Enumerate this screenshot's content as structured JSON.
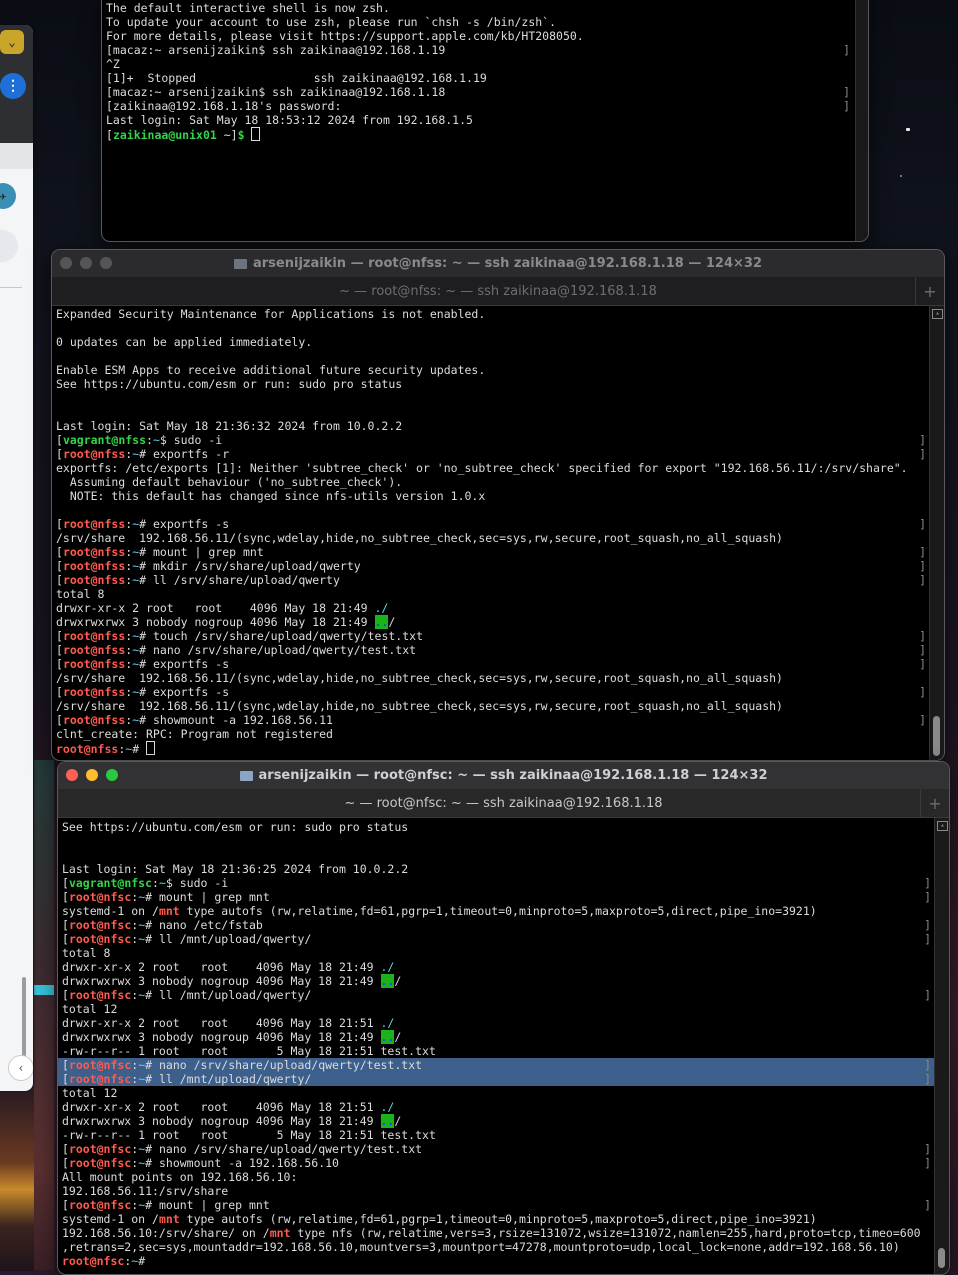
{
  "terminal1": {
    "lines": [
      {
        "t": "The default interactive shell is now zsh."
      },
      {
        "t": "To update your account to use zsh, please run `chsh -s /bin/zsh`."
      },
      {
        "t": "For more details, please visit https://support.apple.com/kb/HT208050."
      },
      {
        "t": "[macaz:~ arsenijzaikin$ ssh zaikinaa@192.168.1.19",
        "rb": "]"
      },
      {
        "t": "^Z"
      },
      {
        "t": "[1]+  Stopped                 ssh zaikinaa@192.168.1.19"
      },
      {
        "t": "[macaz:~ arsenijzaikin$ ssh zaikinaa@192.168.1.18",
        "rb": "]"
      },
      {
        "t": "[zaikinaa@192.168.1.18's password:",
        "rb": "]"
      },
      {
        "t": "Last login: Sat May 18 18:53:12 2024 from 192.168.1.5"
      },
      {
        "segs": [
          {
            "t": "["
          },
          {
            "t": "zaikinaa@unix01",
            "c": "u"
          },
          {
            "t": " ~]"
          },
          {
            "t": "$",
            "c": "u"
          },
          {
            "t": " "
          }
        ],
        "cursor": true
      }
    ]
  },
  "terminal2": {
    "title": "arsenijzaikin — root@nfss: ~ — ssh zaikinaa@192.168.1.18 — 124×32",
    "tab": "~ — root@nfss: ~ — ssh zaikinaa@192.168.1.18",
    "lines": [
      {
        "t": "Expanded Security Maintenance for Applications is not enabled."
      },
      {
        "t": ""
      },
      {
        "t": "0 updates can be applied immediately."
      },
      {
        "t": ""
      },
      {
        "t": "Enable ESM Apps to receive additional future security updates."
      },
      {
        "t": "See https://ubuntu.com/esm or run: sudo pro status"
      },
      {
        "t": ""
      },
      {
        "t": ""
      },
      {
        "t": "Last login: Sat May 18 21:36:32 2024 from 10.0.2.2"
      },
      {
        "segs": [
          {
            "t": "["
          },
          {
            "t": "vagrant@nfss",
            "c": "u"
          },
          {
            "t": ":"
          },
          {
            "t": "~",
            "c": "d"
          },
          {
            "t": "$ sudo -i"
          }
        ],
        "rb": "]"
      },
      {
        "segs": [
          {
            "t": "["
          },
          {
            "t": "root@nfss",
            "c": "r"
          },
          {
            "t": ":"
          },
          {
            "t": "~",
            "c": "d"
          },
          {
            "t": "# exportfs -r"
          }
        ],
        "rb": "]"
      },
      {
        "t": "exportfs: /etc/exports [1]: Neither 'subtree_check' or 'no_subtree_check' specified for export \"192.168.56.11/:/srv/share\"."
      },
      {
        "t": "  Assuming default behaviour ('no_subtree_check')."
      },
      {
        "t": "  NOTE: this default has changed since nfs-utils version 1.0.x"
      },
      {
        "t": ""
      },
      {
        "segs": [
          {
            "t": "["
          },
          {
            "t": "root@nfss",
            "c": "r"
          },
          {
            "t": ":"
          },
          {
            "t": "~",
            "c": "d"
          },
          {
            "t": "# exportfs -s"
          }
        ],
        "rb": "]"
      },
      {
        "t": "/srv/share  192.168.56.11/(sync,wdelay,hide,no_subtree_check,sec=sys,rw,secure,root_squash,no_all_squash)"
      },
      {
        "segs": [
          {
            "t": "["
          },
          {
            "t": "root@nfss",
            "c": "r"
          },
          {
            "t": ":"
          },
          {
            "t": "~",
            "c": "d"
          },
          {
            "t": "# mount | grep mnt"
          }
        ],
        "rb": "]"
      },
      {
        "segs": [
          {
            "t": "["
          },
          {
            "t": "root@nfss",
            "c": "r"
          },
          {
            "t": ":"
          },
          {
            "t": "~",
            "c": "d"
          },
          {
            "t": "# mkdir /srv/share/upload/qwerty"
          }
        ],
        "rb": "]"
      },
      {
        "segs": [
          {
            "t": "["
          },
          {
            "t": "root@nfss",
            "c": "r"
          },
          {
            "t": ":"
          },
          {
            "t": "~",
            "c": "d"
          },
          {
            "t": "# ll /srv/share/upload/qwerty"
          }
        ],
        "rb": "]"
      },
      {
        "t": "total 8"
      },
      {
        "segs": [
          {
            "t": "drwxr-xr-x 2 root   root    4096 May 18 21:49 "
          },
          {
            "t": "./",
            "c": "d"
          }
        ]
      },
      {
        "segs": [
          {
            "t": "drwxrwxrwx 3 nobody nogroup 4096 May 18 21:49 "
          },
          {
            "t": "..",
            "c": "gbg"
          },
          {
            "t": "/"
          }
        ]
      },
      {
        "segs": [
          {
            "t": "["
          },
          {
            "t": "root@nfss",
            "c": "r"
          },
          {
            "t": ":"
          },
          {
            "t": "~",
            "c": "d"
          },
          {
            "t": "# touch /srv/share/upload/qwerty/test.txt"
          }
        ],
        "rb": "]"
      },
      {
        "segs": [
          {
            "t": "["
          },
          {
            "t": "root@nfss",
            "c": "r"
          },
          {
            "t": ":"
          },
          {
            "t": "~",
            "c": "d"
          },
          {
            "t": "# nano /srv/share/upload/qwerty/test.txt"
          }
        ],
        "rb": "]"
      },
      {
        "segs": [
          {
            "t": "["
          },
          {
            "t": "root@nfss",
            "c": "r"
          },
          {
            "t": ":"
          },
          {
            "t": "~",
            "c": "d"
          },
          {
            "t": "# exportfs -s"
          }
        ],
        "rb": "]"
      },
      {
        "t": "/srv/share  192.168.56.11/(sync,wdelay,hide,no_subtree_check,sec=sys,rw,secure,root_squash,no_all_squash)"
      },
      {
        "segs": [
          {
            "t": "["
          },
          {
            "t": "root@nfss",
            "c": "r"
          },
          {
            "t": ":"
          },
          {
            "t": "~",
            "c": "d"
          },
          {
            "t": "# exportfs -s"
          }
        ],
        "rb": "]"
      },
      {
        "t": "/srv/share  192.168.56.11/(sync,wdelay,hide,no_subtree_check,sec=sys,rw,secure,root_squash,no_all_squash)"
      },
      {
        "segs": [
          {
            "t": "["
          },
          {
            "t": "root@nfss",
            "c": "r"
          },
          {
            "t": ":"
          },
          {
            "t": "~",
            "c": "d"
          },
          {
            "t": "# showmount -a 192.168.56.11"
          }
        ],
        "rb": "]"
      },
      {
        "t": "clnt_create: RPC: Program not registered"
      },
      {
        "segs": [
          {
            "t": "root@nfss",
            "c": "r"
          },
          {
            "t": ":"
          },
          {
            "t": "~",
            "c": "d"
          },
          {
            "t": "# "
          }
        ],
        "cursor": true
      }
    ]
  },
  "terminal3": {
    "title": "arsenijzaikin — root@nfsc: ~ — ssh zaikinaa@192.168.1.18 — 124×32",
    "tab": "~ — root@nfsc: ~ — ssh zaikinaa@192.168.1.18",
    "lines": [
      {
        "t": "See https://ubuntu.com/esm or run: sudo pro status"
      },
      {
        "t": ""
      },
      {
        "t": ""
      },
      {
        "t": "Last login: Sat May 18 21:36:25 2024 from 10.0.2.2"
      },
      {
        "segs": [
          {
            "t": "["
          },
          {
            "t": "vagrant@nfsc",
            "c": "u"
          },
          {
            "t": ":"
          },
          {
            "t": "~",
            "c": "d"
          },
          {
            "t": "$ sudo -i"
          }
        ],
        "rb": "]"
      },
      {
        "segs": [
          {
            "t": "["
          },
          {
            "t": "root@nfsc",
            "c": "r"
          },
          {
            "t": ":"
          },
          {
            "t": "~",
            "c": "d"
          },
          {
            "t": "# mount | grep mnt"
          }
        ],
        "rb": "]"
      },
      {
        "segs": [
          {
            "t": "systemd-1 on /"
          },
          {
            "t": "mnt",
            "c": "r"
          },
          {
            "t": " type autofs (rw,relatime,fd=61,pgrp=1,timeout=0,minproto=5,maxproto=5,direct,pipe_ino=3921)"
          }
        ]
      },
      {
        "segs": [
          {
            "t": "["
          },
          {
            "t": "root@nfsc",
            "c": "r"
          },
          {
            "t": ":"
          },
          {
            "t": "~",
            "c": "d"
          },
          {
            "t": "# nano /etc/fstab"
          }
        ],
        "rb": "]"
      },
      {
        "segs": [
          {
            "t": "["
          },
          {
            "t": "root@nfsc",
            "c": "r"
          },
          {
            "t": ":"
          },
          {
            "t": "~",
            "c": "d"
          },
          {
            "t": "# ll /mnt/upload/qwerty/"
          }
        ],
        "rb": "]"
      },
      {
        "t": "total 8"
      },
      {
        "segs": [
          {
            "t": "drwxr-xr-x 2 root   root    4096 May 18 21:49 "
          },
          {
            "t": "./",
            "c": "d"
          }
        ]
      },
      {
        "segs": [
          {
            "t": "drwxrwxrwx 3 nobody nogroup 4096 May 18 21:49 "
          },
          {
            "t": "..",
            "c": "gbg"
          },
          {
            "t": "/"
          }
        ]
      },
      {
        "segs": [
          {
            "t": "["
          },
          {
            "t": "root@nfsc",
            "c": "r"
          },
          {
            "t": ":"
          },
          {
            "t": "~",
            "c": "d"
          },
          {
            "t": "# ll /mnt/upload/qwerty/"
          }
        ],
        "rb": "]"
      },
      {
        "t": "total 12"
      },
      {
        "segs": [
          {
            "t": "drwxr-xr-x 2 root   root    4096 May 18 21:51 "
          },
          {
            "t": "./",
            "c": "d"
          }
        ]
      },
      {
        "segs": [
          {
            "t": "drwxrwxrwx 3 nobody nogroup 4096 May 18 21:49 "
          },
          {
            "t": "..",
            "c": "gbg"
          },
          {
            "t": "/"
          }
        ]
      },
      {
        "t": "-rw-r--r-- 1 root   root       5 May 18 21:51 test.txt"
      },
      {
        "segs": [
          {
            "t": "["
          },
          {
            "t": "root@nfsc",
            "c": "r"
          },
          {
            "t": ":"
          },
          {
            "t": "~",
            "c": "d"
          },
          {
            "t": "# nano /srv/share/upload/qwerty/test.txt"
          }
        ],
        "rb": "]",
        "hl": true
      },
      {
        "segs": [
          {
            "t": "["
          },
          {
            "t": "root@nfsc",
            "c": "r"
          },
          {
            "t": ":"
          },
          {
            "t": "~",
            "c": "d"
          },
          {
            "t": "# ll /mnt/upload/qwerty/"
          }
        ],
        "rb": "]",
        "hl": true
      },
      {
        "t": "total 12"
      },
      {
        "segs": [
          {
            "t": "drwxr-xr-x 2 root   root    4096 May 18 21:51 "
          },
          {
            "t": "./",
            "c": "d"
          }
        ]
      },
      {
        "segs": [
          {
            "t": "drwxrwxrwx 3 nobody nogroup 4096 May 18 21:49 "
          },
          {
            "t": "..",
            "c": "gbg"
          },
          {
            "t": "/"
          }
        ]
      },
      {
        "t": "-rw-r--r-- 1 root   root       5 May 18 21:51 test.txt"
      },
      {
        "segs": [
          {
            "t": "["
          },
          {
            "t": "root@nfsc",
            "c": "r"
          },
          {
            "t": ":"
          },
          {
            "t": "~",
            "c": "d"
          },
          {
            "t": "# nano /srv/share/upload/qwerty/test.txt"
          }
        ],
        "rb": "]"
      },
      {
        "segs": [
          {
            "t": "["
          },
          {
            "t": "root@nfsc",
            "c": "r"
          },
          {
            "t": ":"
          },
          {
            "t": "~",
            "c": "d"
          },
          {
            "t": "# showmount -a 192.168.56.10"
          }
        ],
        "rb": "]"
      },
      {
        "t": "All mount points on 192.168.56.10:"
      },
      {
        "t": "192.168.56.11:/srv/share"
      },
      {
        "segs": [
          {
            "t": "["
          },
          {
            "t": "root@nfsc",
            "c": "r"
          },
          {
            "t": ":"
          },
          {
            "t": "~",
            "c": "d"
          },
          {
            "t": "# mount | grep mnt"
          }
        ],
        "rb": "]"
      },
      {
        "segs": [
          {
            "t": "systemd-1 on /"
          },
          {
            "t": "mnt",
            "c": "r"
          },
          {
            "t": " type autofs (rw,relatime,fd=61,pgrp=1,timeout=0,minproto=5,maxproto=5,direct,pipe_ino=3921)"
          }
        ]
      },
      {
        "segs": [
          {
            "t": "192.168.56.10:/srv/share/ on /"
          },
          {
            "t": "mnt",
            "c": "r"
          },
          {
            "t": " type nfs (rw,relatime,vers=3,rsize=131072,wsize=131072,namlen=255,hard,proto=tcp,timeo=600"
          }
        ]
      },
      {
        "t": ",retrans=2,sec=sys,mountaddr=192.168.56.10,mountvers=3,mountport=47278,mountproto=udp,local_lock=none,addr=192.168.56.10)"
      },
      {
        "segs": [
          {
            "t": "root@nfsc",
            "c": "r"
          },
          {
            "t": ":"
          },
          {
            "t": "~",
            "c": "d"
          },
          {
            "t": "# "
          }
        ]
      }
    ]
  }
}
